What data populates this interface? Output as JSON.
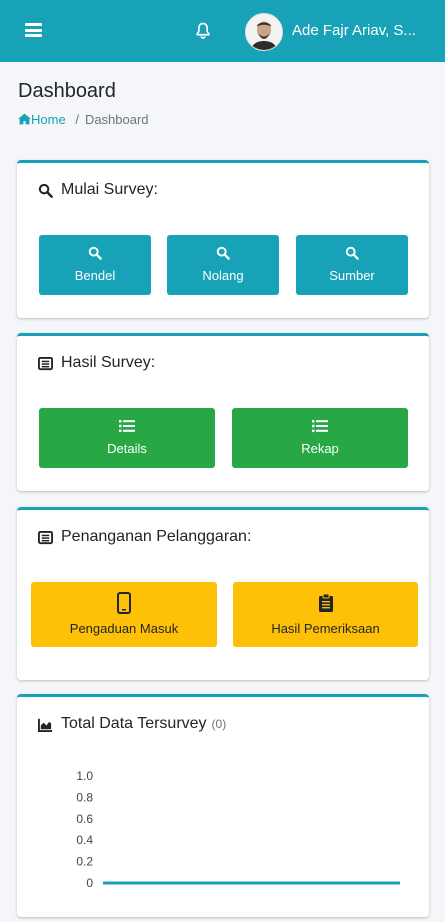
{
  "header": {
    "user_name": "Ade Fajr Ariav, S...",
    "colors": {
      "primary": "#17a2b8",
      "success": "#28a745",
      "warning": "#ffc107"
    }
  },
  "page": {
    "title": "Dashboard",
    "breadcrumb": {
      "home": "Home",
      "separator": "/",
      "current": "Dashboard"
    }
  },
  "mulai_survey": {
    "title": "Mulai Survey:",
    "buttons": [
      "Bendel",
      "Nolang",
      "Sumber"
    ]
  },
  "hasil_survey": {
    "title": "Hasil Survey:",
    "buttons": [
      "Details",
      "Rekap"
    ]
  },
  "penanganan": {
    "title": "Penanganan Pelanggaran:",
    "buttons": [
      "Pengaduan Masuk",
      "Hasil Pemeriksaan"
    ]
  },
  "total_data": {
    "title": "Total Data Tersurvey",
    "count": "(0)"
  },
  "chart_data": {
    "type": "line",
    "title": "",
    "yticks": [
      "1.0",
      "0.8",
      "0.6",
      "0.4",
      "0.2",
      "0"
    ],
    "ylim": [
      0,
      1
    ],
    "series": [
      {
        "values": [
          0,
          0
        ]
      }
    ]
  }
}
